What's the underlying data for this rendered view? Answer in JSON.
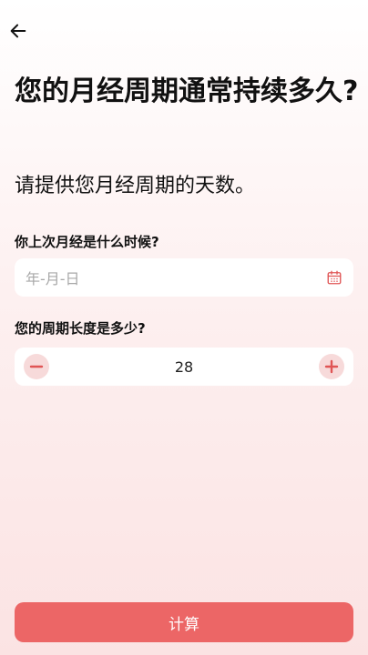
{
  "header": {
    "back_icon": "arrow-left-icon"
  },
  "page": {
    "title": "您的月经周期通常持续多久?",
    "subtitle": "请提供您月经周期的天数。"
  },
  "last_period": {
    "label": "你上次月经是什么时候?",
    "placeholder": "年-月-日",
    "icon": "calendar-icon"
  },
  "cycle_length": {
    "label": "您的周期长度是多少?",
    "value": "28",
    "decrement_icon": "minus-icon",
    "increment_icon": "plus-icon"
  },
  "actions": {
    "calculate_label": "计算"
  },
  "colors": {
    "accent": "#ec6666",
    "stepper_button_bg": "#f7dada",
    "icon_red": "#e05555"
  }
}
